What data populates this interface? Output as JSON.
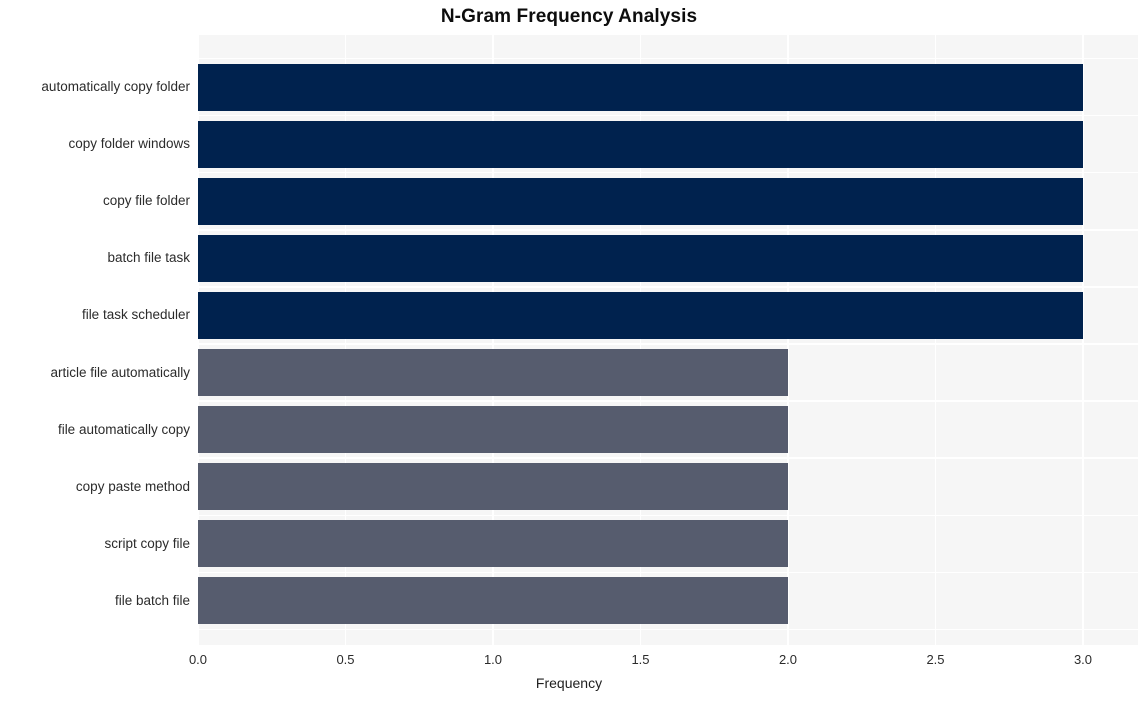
{
  "chart_data": {
    "type": "bar",
    "orientation": "horizontal",
    "title": "N-Gram Frequency Analysis",
    "xlabel": "Frequency",
    "ylabel": "",
    "xlim": [
      0.0,
      3.0
    ],
    "xticks": [
      "0.0",
      "0.5",
      "1.0",
      "1.5",
      "2.0",
      "2.5",
      "3.0"
    ],
    "xtick_values": [
      0.0,
      0.5,
      1.0,
      1.5,
      2.0,
      2.5,
      3.0
    ],
    "grid": true,
    "grid_color": "#ffffff",
    "plot_background": "#f6f6f6",
    "legend": null,
    "categories": [
      "automatically copy folder",
      "copy folder windows",
      "copy file folder",
      "batch file task",
      "file task scheduler",
      "article file automatically",
      "file automatically copy",
      "copy paste method",
      "script copy file",
      "file batch file"
    ],
    "values": [
      3,
      3,
      3,
      3,
      3,
      2,
      2,
      2,
      2,
      2
    ],
    "bar_colors": [
      "#00224e",
      "#00224e",
      "#00224e",
      "#00224e",
      "#00224e",
      "#565c6e",
      "#565c6e",
      "#565c6e",
      "#565c6e",
      "#565c6e"
    ],
    "palette": {
      "high": "#00224e",
      "low": "#565c6e"
    }
  }
}
